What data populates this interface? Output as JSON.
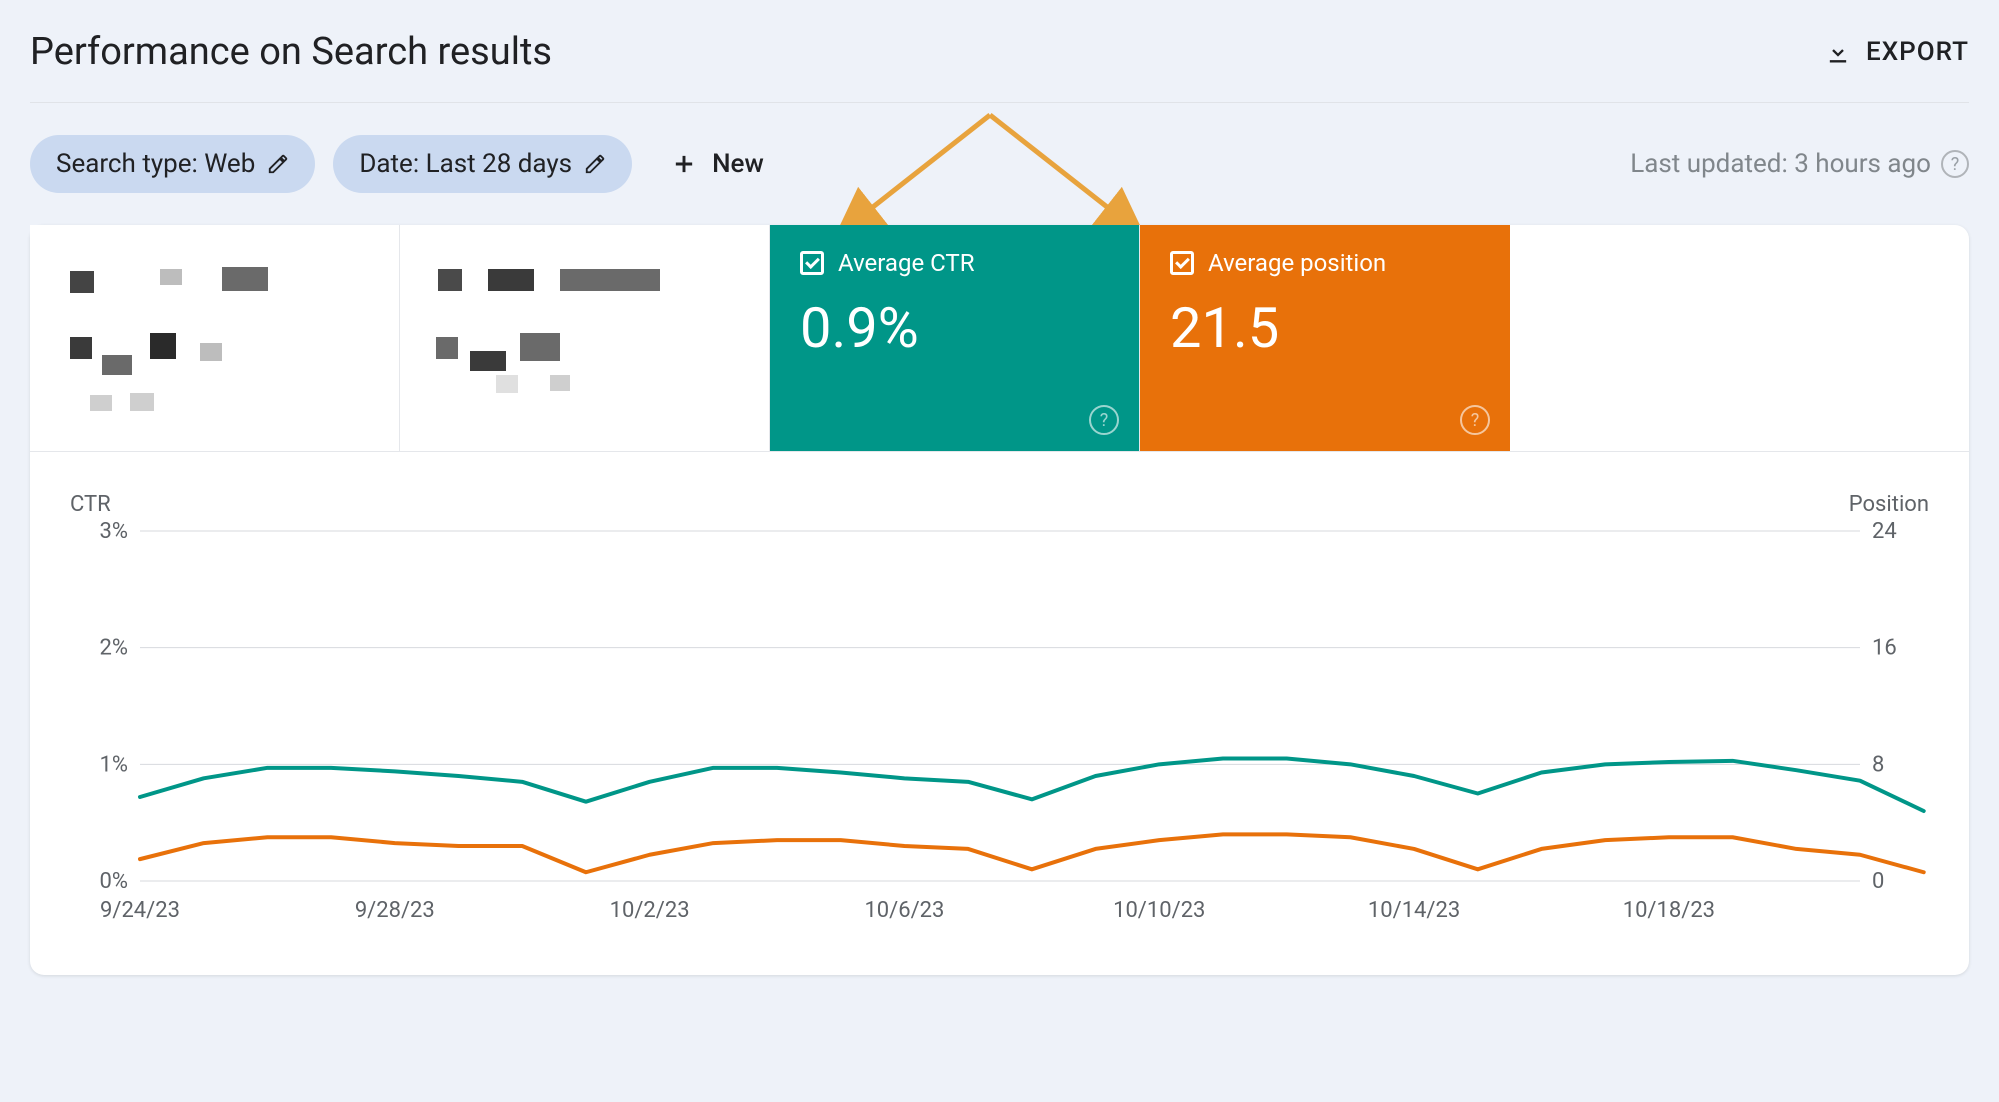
{
  "header": {
    "title": "Performance on Search results",
    "export_label": "EXPORT"
  },
  "filters": {
    "search_type": "Search type: Web",
    "date_range": "Date: Last 28 days",
    "add_new_label": "New",
    "last_updated": "Last updated: 3 hours ago"
  },
  "metrics": {
    "ctr": {
      "label": "Average CTR",
      "value": "0.9%"
    },
    "position": {
      "label": "Average position",
      "value": "21.5"
    }
  },
  "chart": {
    "left_axis_label": "CTR",
    "right_axis_label": "Position"
  },
  "chart_data": {
    "type": "line",
    "title": "Performance on Search results",
    "x": [
      "9/24/23",
      "9/25/23",
      "9/26/23",
      "9/27/23",
      "9/28/23",
      "9/29/23",
      "9/30/23",
      "10/1/23",
      "10/2/23",
      "10/3/23",
      "10/4/23",
      "10/5/23",
      "10/6/23",
      "10/7/23",
      "10/8/23",
      "10/9/23",
      "10/10/23",
      "10/11/23",
      "10/12/23",
      "10/13/23",
      "10/14/23",
      "10/15/23",
      "10/16/23",
      "10/17/23",
      "10/18/23",
      "10/19/23",
      "10/20/23",
      "10/21/23"
    ],
    "x_ticks": [
      "9/24/23",
      "9/28/23",
      "10/2/23",
      "10/6/23",
      "10/10/23",
      "10/14/23",
      "10/18/23"
    ],
    "series": [
      {
        "name": "Average CTR",
        "axis": "left",
        "color": "#009688",
        "values": [
          0.72,
          0.88,
          0.97,
          0.97,
          0.94,
          0.9,
          0.85,
          0.68,
          0.85,
          0.97,
          0.97,
          0.93,
          0.88,
          0.85,
          0.7,
          0.9,
          1.0,
          1.05,
          1.05,
          1.0,
          0.9,
          0.75,
          0.93,
          1.0,
          1.02,
          1.03,
          0.95,
          0.86,
          0.6
        ]
      },
      {
        "name": "Average position",
        "axis": "right",
        "color": "#e8710a",
        "values": [
          22.5,
          21.4,
          21.0,
          21.0,
          21.4,
          21.6,
          21.6,
          23.4,
          22.2,
          21.4,
          21.2,
          21.2,
          21.6,
          21.8,
          23.2,
          21.8,
          21.2,
          20.8,
          20.8,
          21.0,
          21.8,
          23.2,
          21.8,
          21.2,
          21.0,
          21.0,
          21.8,
          22.2,
          23.4
        ]
      }
    ],
    "left_axis": {
      "label": "CTR",
      "ticks": [
        0,
        1,
        2,
        3
      ],
      "tick_labels": [
        "0%",
        "1%",
        "2%",
        "3%"
      ],
      "range": [
        0,
        3
      ]
    },
    "right_axis": {
      "label": "Position",
      "ticks": [
        0,
        8,
        16,
        24
      ],
      "range": [
        24,
        0
      ],
      "inverted": true
    },
    "grid": true
  }
}
